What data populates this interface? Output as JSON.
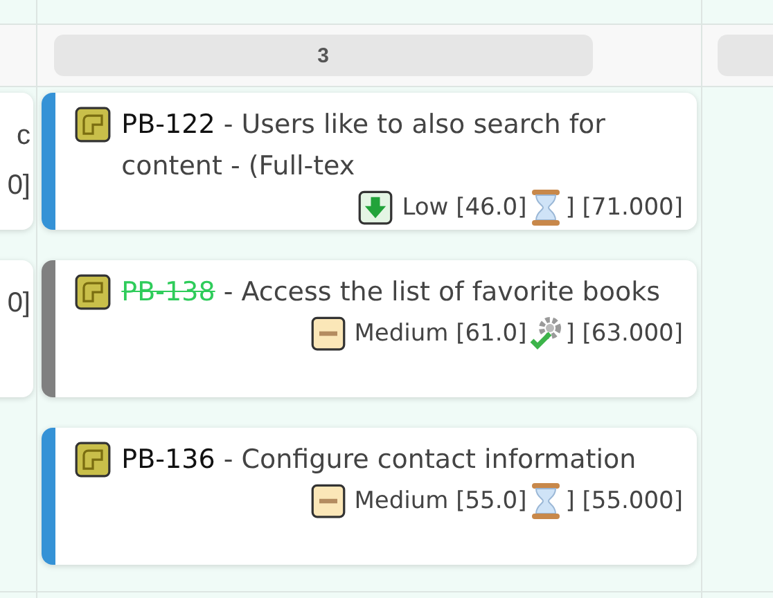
{
  "left_column": {
    "cards": [
      {
        "texts": [
          "c",
          "0]"
        ]
      },
      {
        "texts": [
          "0]"
        ]
      }
    ]
  },
  "group": {
    "header": "3",
    "cards": [
      {
        "color": "#3592d6",
        "id": "PB-122",
        "done": false,
        "title": "- Users like to also search for content - (Full-tex",
        "priority": {
          "kind": "low",
          "label": "Low [46.0]"
        },
        "status": {
          "kind": "waiting"
        },
        "estimate": "] [71.000]"
      },
      {
        "color": "#808080",
        "id": "PB-138",
        "done": true,
        "title": "- Access the list of favorite books",
        "priority": {
          "kind": "medium",
          "label": "Medium [61.0]"
        },
        "status": {
          "kind": "done"
        },
        "estimate": "] [63.000]"
      },
      {
        "color": "#3592d6",
        "id": "PB-136",
        "done": false,
        "title": "- Configure contact information",
        "priority": {
          "kind": "medium",
          "label": "Medium [55.0]"
        },
        "status": {
          "kind": "waiting"
        },
        "estimate": "] [55.000]"
      }
    ]
  }
}
